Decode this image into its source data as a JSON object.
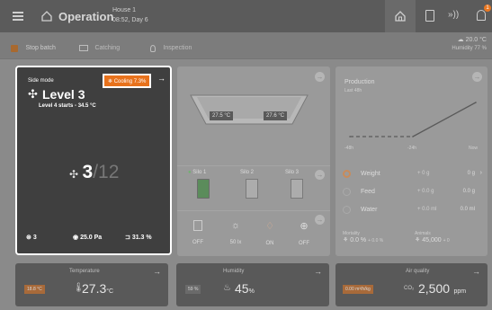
{
  "header": {
    "title": "Operation",
    "house": "House 1",
    "time": "08:52, Day 6",
    "notification_count": "1"
  },
  "actions": {
    "stop_batch": "Stop batch",
    "catching": "Catching",
    "inspection": "Inspection",
    "temperature": "20.0 °C",
    "humidity": "Humidity 77 %"
  },
  "side_mode": {
    "label": "Side mode",
    "cooling_badge": "Cooling 7.3%",
    "level": "Level 3",
    "level_info": "Level 4 starts - 34.5 °C",
    "fans_on": "3",
    "fans_total": "/12",
    "stat_fans": "3",
    "stat_pressure": "25.0 Pa",
    "stat_opening": "31.3 %"
  },
  "feeder": {
    "temp_left": "27.5 °C",
    "temp_right": "27.6 °C",
    "silos": [
      "Silo 1",
      "Silo 2",
      "Silo 3"
    ],
    "controls": [
      "OFF",
      "50 lx",
      "ON",
      "OFF"
    ]
  },
  "production": {
    "title": "Production",
    "subtitle": "Last 48h",
    "x_labels": [
      "-48h",
      "-24h",
      "Now"
    ],
    "rows": [
      {
        "label": "Weight",
        "delta": "+ 0 g",
        "value": "0 g"
      },
      {
        "label": "Feed",
        "delta": "+ 0.0 g",
        "value": "0.0 g"
      },
      {
        "label": "Water",
        "delta": "+ 0.0 ml",
        "value": "0.0 ml"
      }
    ],
    "mortality_label": "Mortality",
    "mortality_value": "0.0 %",
    "mortality_delta": "+ 0.0 %",
    "animals_label": "Animals",
    "animals_value": "45,000",
    "animals_delta": "+ 0"
  },
  "chart_data": {
    "type": "line",
    "title": "Production",
    "subtitle": "Last 48h",
    "categories": [
      "-48h",
      "-24h",
      "Now"
    ],
    "series": [
      {
        "values": [
          0,
          0,
          1
        ]
      }
    ]
  },
  "bottom": {
    "temperature": {
      "label": "Temperature",
      "badge": "18.8 °C",
      "value": "27.3",
      "unit": "°C"
    },
    "humidity": {
      "label": "Humidity",
      "badge": "59 %",
      "value": "45",
      "unit": "%"
    },
    "air": {
      "label": "Air quality",
      "badge": "0.00 m³/h/kg",
      "prefix": "CO₂",
      "value": "2,500",
      "unit": "ppm"
    }
  },
  "colors": {
    "accent": "#e87722",
    "cooling_badge": "#e8721c",
    "silo_green": "#4caf50"
  }
}
